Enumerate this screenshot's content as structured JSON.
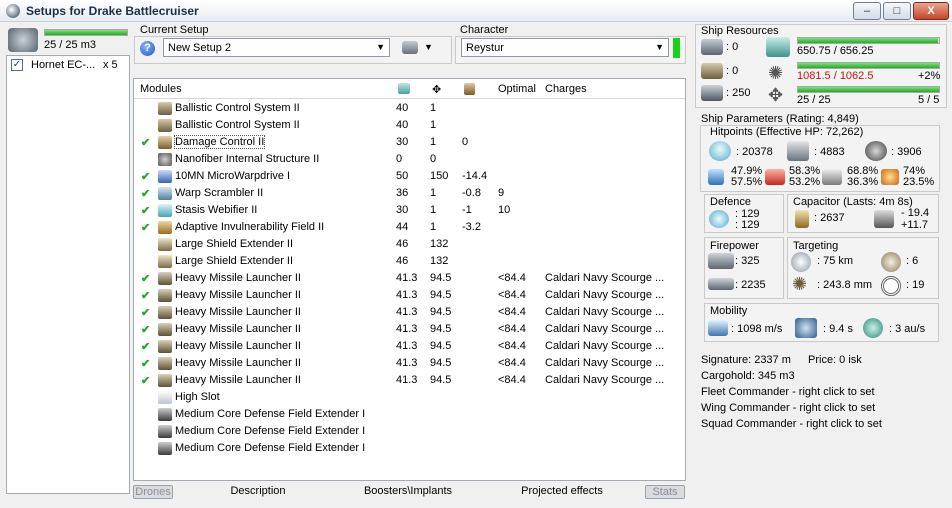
{
  "window": {
    "title": "Setups for Drake Battlecruiser",
    "min": "‒",
    "max": "□",
    "close": "X"
  },
  "drones": {
    "bay": "25 / 25 m3",
    "bay_fill": 1.0,
    "items": [
      {
        "name": "Hornet EC-...",
        "qty": "x 5",
        "checked": true
      }
    ]
  },
  "setup": {
    "label": "Current Setup",
    "value": "New Setup 2"
  },
  "character": {
    "label": "Character",
    "value": "Reystur"
  },
  "grid": {
    "headers": {
      "modules": "Modules",
      "optimal": "Optimal",
      "charges": "Charges"
    },
    "rows": [
      {
        "check": false,
        "icon": "ballistic-control-icon",
        "name": "Ballistic Control System II",
        "c1": "40",
        "c2": "1",
        "c3": "",
        "optimal": "",
        "charges": ""
      },
      {
        "check": false,
        "icon": "ballistic-control-icon",
        "name": "Ballistic Control System II",
        "c1": "40",
        "c2": "1",
        "c3": "",
        "optimal": "",
        "charges": ""
      },
      {
        "check": true,
        "icon": "damage-control-icon",
        "name": "Damage Control II",
        "c1": "30",
        "c2": "1",
        "c3": "0",
        "optimal": "",
        "charges": ""
      },
      {
        "check": false,
        "icon": "nanofiber-icon",
        "name": "Nanofiber Internal Structure II",
        "c1": "0",
        "c2": "0",
        "c3": "",
        "optimal": "",
        "charges": ""
      },
      {
        "check": true,
        "icon": "microwarpdrive-icon",
        "name": "10MN MicroWarpdrive I",
        "c1": "50",
        "c2": "150",
        "c3": "-14.4",
        "optimal": "",
        "charges": ""
      },
      {
        "check": true,
        "icon": "warp-scrambler-icon",
        "name": "Warp Scrambler II",
        "c1": "36",
        "c2": "1",
        "c3": "-0.8",
        "optimal": "9",
        "charges": ""
      },
      {
        "check": true,
        "icon": "stasis-webifier-icon",
        "name": "Stasis Webifier II",
        "c1": "30",
        "c2": "1",
        "c3": "-1",
        "optimal": "10",
        "charges": ""
      },
      {
        "check": true,
        "icon": "invulnerability-field-icon",
        "name": "Adaptive Invulnerability Field II",
        "c1": "44",
        "c2": "1",
        "c3": "-3.2",
        "optimal": "",
        "charges": ""
      },
      {
        "check": false,
        "icon": "shield-extender-icon",
        "name": "Large Shield Extender II",
        "c1": "46",
        "c2": "132",
        "c3": "",
        "optimal": "",
        "charges": ""
      },
      {
        "check": false,
        "icon": "shield-extender-icon",
        "name": "Large Shield Extender II",
        "c1": "46",
        "c2": "132",
        "c3": "",
        "optimal": "",
        "charges": ""
      },
      {
        "check": true,
        "icon": "missile-launcher-icon",
        "name": "Heavy Missile Launcher II",
        "c1": "41.3",
        "c2": "94.5",
        "c3": "",
        "optimal": "<84.4",
        "charges": "Caldari Navy Scourge ..."
      },
      {
        "check": true,
        "icon": "missile-launcher-icon",
        "name": "Heavy Missile Launcher II",
        "c1": "41.3",
        "c2": "94.5",
        "c3": "",
        "optimal": "<84.4",
        "charges": "Caldari Navy Scourge ..."
      },
      {
        "check": true,
        "icon": "missile-launcher-icon",
        "name": "Heavy Missile Launcher II",
        "c1": "41.3",
        "c2": "94.5",
        "c3": "",
        "optimal": "<84.4",
        "charges": "Caldari Navy Scourge ..."
      },
      {
        "check": true,
        "icon": "missile-launcher-icon",
        "name": "Heavy Missile Launcher II",
        "c1": "41.3",
        "c2": "94.5",
        "c3": "",
        "optimal": "<84.4",
        "charges": "Caldari Navy Scourge ..."
      },
      {
        "check": true,
        "icon": "missile-launcher-icon",
        "name": "Heavy Missile Launcher II",
        "c1": "41.3",
        "c2": "94.5",
        "c3": "",
        "optimal": "<84.4",
        "charges": "Caldari Navy Scourge ..."
      },
      {
        "check": true,
        "icon": "missile-launcher-icon",
        "name": "Heavy Missile Launcher II",
        "c1": "41.3",
        "c2": "94.5",
        "c3": "",
        "optimal": "<84.4",
        "charges": "Caldari Navy Scourge ..."
      },
      {
        "check": true,
        "icon": "missile-launcher-icon",
        "name": "Heavy Missile Launcher II",
        "c1": "41.3",
        "c2": "94.5",
        "c3": "",
        "optimal": "<84.4",
        "charges": "Caldari Navy Scourge ..."
      },
      {
        "check": false,
        "icon": "high-slot-icon",
        "name": "High Slot",
        "c1": "",
        "c2": "",
        "c3": "",
        "optimal": "",
        "charges": ""
      },
      {
        "check": false,
        "icon": "rig-icon",
        "name": "Medium Core Defense Field Extender I",
        "c1": "",
        "c2": "",
        "c3": "",
        "optimal": "",
        "charges": ""
      },
      {
        "check": false,
        "icon": "rig-icon",
        "name": "Medium Core Defense Field Extender I",
        "c1": "",
        "c2": "",
        "c3": "",
        "optimal": "",
        "charges": ""
      },
      {
        "check": false,
        "icon": "rig-icon",
        "name": "Medium Core Defense Field Extender I",
        "c1": "",
        "c2": "",
        "c3": "",
        "optimal": "",
        "charges": ""
      }
    ]
  },
  "tabs": {
    "drones": "Drones",
    "description": "Description",
    "boosters": "Boosters\\Implants",
    "projected": "Projected effects",
    "stats": "Stats"
  },
  "resources": {
    "title": "Ship Resources",
    "turret": ": 0",
    "launcher": ": 0",
    "calibration": ": 250",
    "cpu": "650.75 / 656.25",
    "cpu_fill": 0.99,
    "power": "1081.5 / 1062.5",
    "power_pct": "+2%",
    "power_fill": 1.0,
    "drone_bw": "25 / 25",
    "drone_cnt": "5 / 5",
    "drone_fill": 1.0
  },
  "params": {
    "title": "Ship Parameters (Rating: 4,849)",
    "hp_title": "Hitpoints (Effective HP: 72,262)",
    "shield_hp": ": 20378",
    "armor_hp": ": 4883",
    "struct_hp": ": 3906",
    "res": {
      "em": [
        "47.9%",
        "57.5%"
      ],
      "th": [
        "58.3%",
        "53.2%"
      ],
      "kin": [
        "68.8%",
        "36.3%"
      ],
      "exp": [
        "74%",
        "23.5%"
      ]
    },
    "defence_title": "Defence",
    "defence": [
      ": 129",
      ": 129"
    ],
    "cap_title": "Capacitor (Lasts: 4m 8s)",
    "cap_amount": ": 2637",
    "cap_rates": [
      "- 19.4",
      "+11.7"
    ],
    "fire_title": "Firepower",
    "dps": ": 325",
    "volley": ": 2235",
    "target_title": "Targeting",
    "range": ": 75 km",
    "targets": ": 6",
    "scan": ": 243.8 mm",
    "sigres": ": 19",
    "mob_title": "Mobility",
    "speed": ": 1098 m/s",
    "align": ": 9.4 s",
    "warp": ": 3 au/s",
    "signature": "Signature: 2337 m",
    "price": "Price: 0 isk",
    "cargo": "Cargohold: 345 m3",
    "fleet": "Fleet Commander - right click to set",
    "wing": "Wing Commander - right click to set",
    "squad": "Squad Commander - right click to set"
  }
}
